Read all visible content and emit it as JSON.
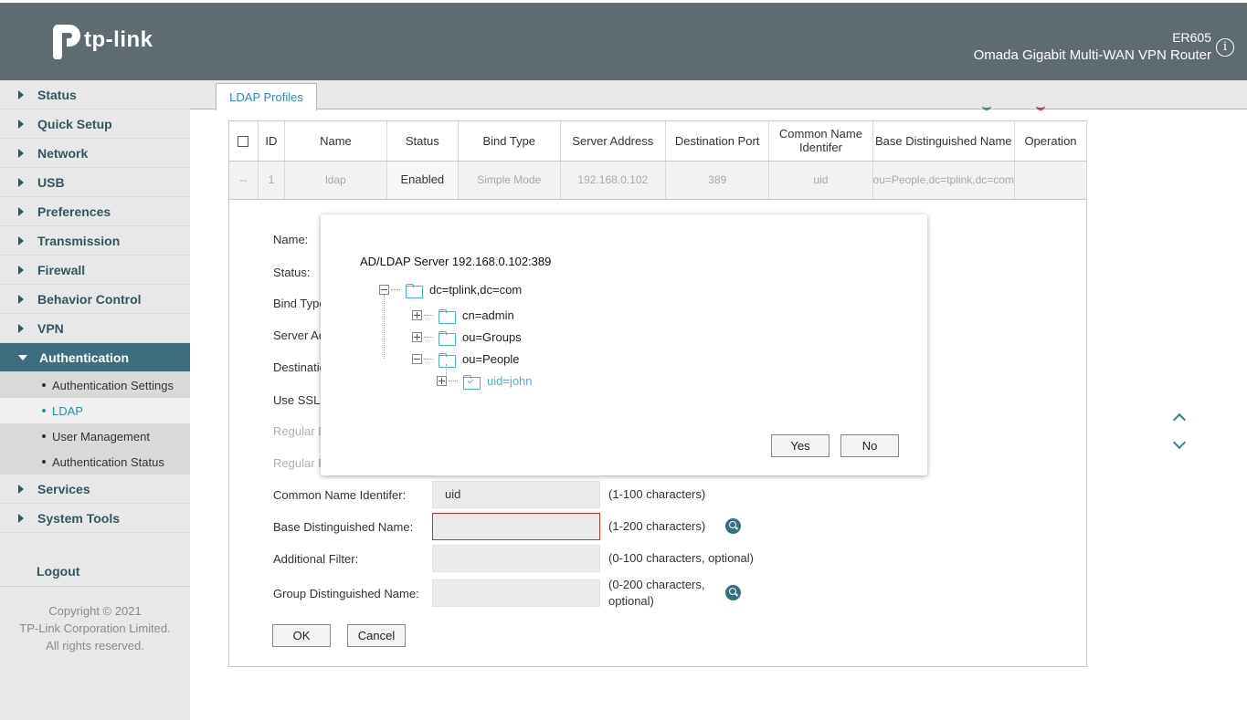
{
  "header": {
    "brand": "tp-link",
    "model": "ER605",
    "product": "Omada Gigabit Multi-WAN VPN Router",
    "info_icon": "i"
  },
  "sidebar": {
    "items": [
      {
        "label": "Status"
      },
      {
        "label": "Quick Setup"
      },
      {
        "label": "Network"
      },
      {
        "label": "USB"
      },
      {
        "label": "Preferences"
      },
      {
        "label": "Transmission"
      },
      {
        "label": "Firewall"
      },
      {
        "label": "Behavior Control"
      },
      {
        "label": "VPN"
      },
      {
        "label": "Authentication"
      },
      {
        "label": "Services"
      },
      {
        "label": "System Tools"
      }
    ],
    "sub_items": [
      {
        "label": "Authentication Settings"
      },
      {
        "label": "LDAP"
      },
      {
        "label": "User Management"
      },
      {
        "label": "Authentication Status"
      }
    ],
    "logout": "Logout",
    "copyright": [
      "Copyright © 2021",
      "TP-Link Corporation Limited.",
      "All rights reserved."
    ]
  },
  "tab": {
    "label": "LDAP Profiles"
  },
  "table": {
    "headers": [
      "ID",
      "Name",
      "Status",
      "Bind Type",
      "Server Address",
      "Destination Port",
      "Common Name Identifer",
      "Base Distinguished Name",
      "Operation"
    ],
    "row": {
      "select": "--",
      "id": "1",
      "name": "ldap",
      "status": "Enabled",
      "bind_type": "Simple Mode",
      "server": "192.168.0.102",
      "port": "389",
      "cn": "uid",
      "base_dn": "ou=People,dc=tplink,dc=com",
      "operation": ""
    }
  },
  "form": {
    "name_label": "Name:",
    "status_label": "Status:",
    "bind_label": "Bind Type",
    "server_label": "Server Ad",
    "dest_label": "Destinatio",
    "ssl_label": "Use SSL:",
    "regular_d_label": "Regular D",
    "regular_p_label": "Regular P",
    "cn_label": "Common Name Identifer:",
    "cn_value": "uid",
    "cn_hint": "(1-100 characters)",
    "base_dn_label": "Base Distinguished Name:",
    "base_dn_value": "",
    "base_dn_hint": "(1-200 characters)",
    "filter_label": "Additional Filter:",
    "filter_value": "",
    "filter_hint": "(0-100 characters, optional)",
    "group_dn_label": "Group Distinguished Name:",
    "group_dn_value": "",
    "group_dn_hint_1": "(0-200 characters,",
    "group_dn_hint_2": "optional)",
    "ok": "OK",
    "cancel": "Cancel"
  },
  "modal": {
    "title": "AD/LDAP Server 192.168.0.102:389",
    "tree": {
      "root": "dc=tplink,dc=com",
      "children": [
        "cn=admin",
        "ou=Groups",
        "ou=People"
      ],
      "grandchild": "uid=john"
    },
    "yes": "Yes",
    "no": "No"
  },
  "colors": {
    "header_bg": "#5e6b71",
    "sidebar_active": "#3e6e7e",
    "accent": "#2a8ea8",
    "tree_selected": "#45b4d3",
    "error_border": "#cc3333"
  },
  "icons": [
    "tp-link-logo-icon",
    "info-icon",
    "triangle-right-icon",
    "triangle-down-icon",
    "checkbox-icon",
    "search-icon",
    "chevron-up-icon",
    "chevron-down-icon",
    "folder-icon",
    "folder-checked-icon",
    "tree-expand-icon",
    "tree-collapse-icon"
  ]
}
